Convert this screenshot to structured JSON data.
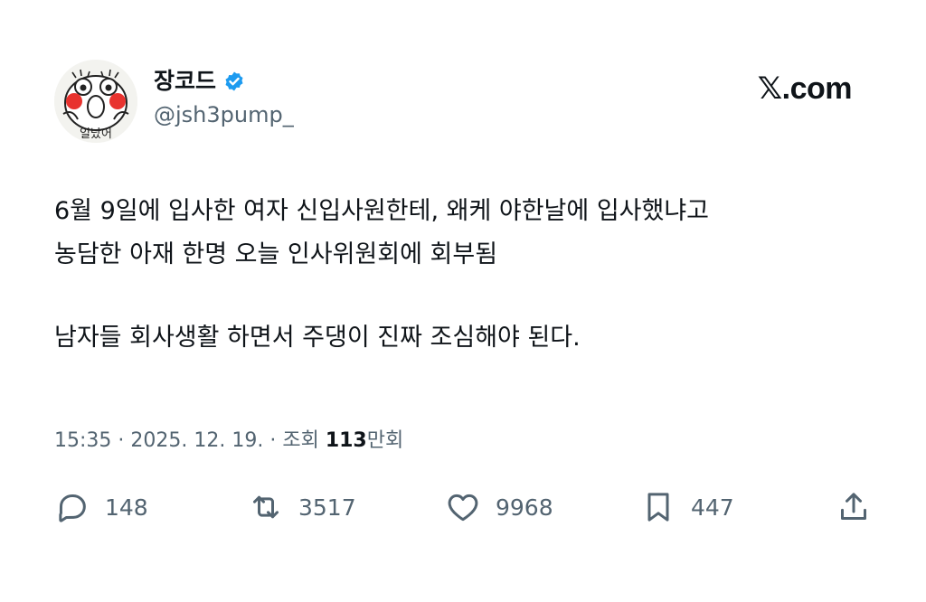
{
  "author": {
    "display_name": "장코드",
    "handle": "@jsh3pump_",
    "avatar_caption": "일났어",
    "verified_color": "#1d9bf0"
  },
  "site_logo": "𝕏.com",
  "tweet": {
    "paragraph1": "6월 9일에 입사한 여자 신입사원한테, 왜케 야한날에 입사했냐고\n농담한 아재 한명 오늘 인사위원회에 회부됨",
    "paragraph2": "남자들 회사생활 하면서 주댕이 진짜 조심해야 된다."
  },
  "meta": {
    "time": "15:35",
    "separator": " · ",
    "date": "2025. 12. 19.",
    "views_label": "조회",
    "views_num": "113",
    "views_unit": "만회"
  },
  "actions": {
    "replies": "148",
    "reposts": "3517",
    "likes": "9968",
    "bookmarks": "447"
  }
}
